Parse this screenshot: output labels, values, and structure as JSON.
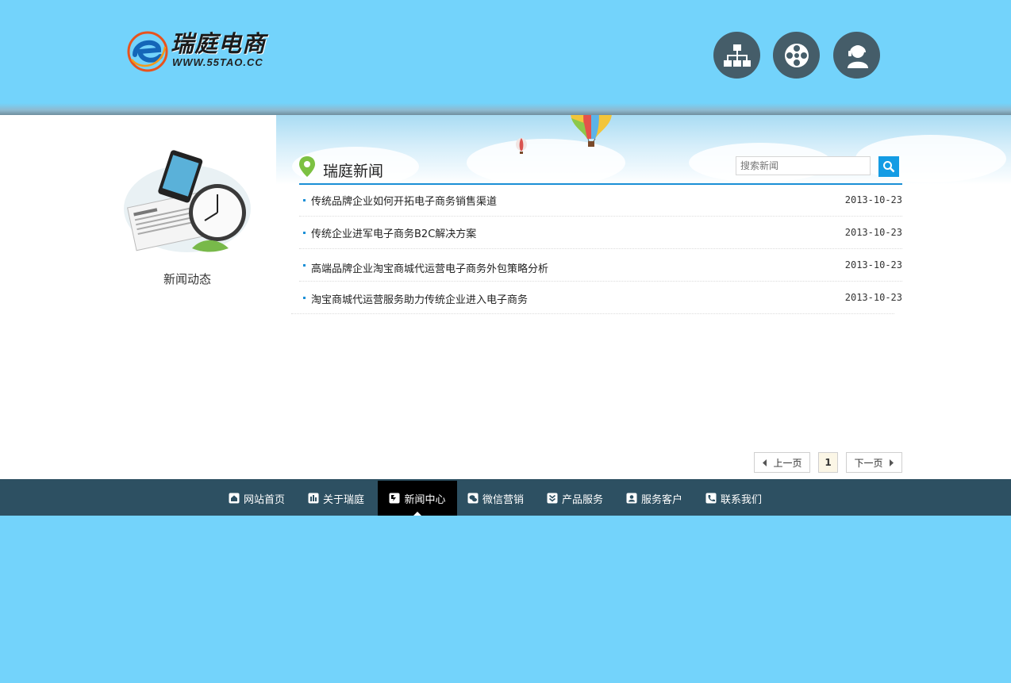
{
  "header": {
    "logo_cn": "瑞庭电商",
    "logo_en": "WWW.55TAO.CC",
    "icons": [
      "sitemap-icon",
      "film-reel-icon",
      "customer-service-icon"
    ]
  },
  "sidebar": {
    "title": "新闻动态"
  },
  "section": {
    "title": "瑞庭新闻",
    "search_placeholder": "搜索新闻"
  },
  "news": [
    {
      "title": "传统品牌企业如何开拓电子商务销售渠道",
      "date": "2013-10-23"
    },
    {
      "title": "传统企业进军电子商务B2C解决方案",
      "date": "2013-10-23"
    },
    {
      "title": "高端品牌企业淘宝商城代运营电子商务外包策略分析",
      "date": "2013-10-23"
    },
    {
      "title": "淘宝商城代运营服务助力传统企业进入电子商务",
      "date": "2013-10-23"
    }
  ],
  "pagination": {
    "prev": "上一页",
    "current": "1",
    "next": "下一页"
  },
  "nav": [
    {
      "label": "网站首页",
      "icon": "home-icon"
    },
    {
      "label": "关于瑞庭",
      "icon": "chart-icon"
    },
    {
      "label": "新闻中心",
      "icon": "news-icon"
    },
    {
      "label": "微信营销",
      "icon": "wechat-icon"
    },
    {
      "label": "产品服务",
      "icon": "product-icon"
    },
    {
      "label": "服务客户",
      "icon": "client-icon"
    },
    {
      "label": "联系我们",
      "icon": "phone-icon"
    }
  ],
  "colors": {
    "sky": "#73d3fb",
    "nav_bg": "#2d5062",
    "nav_active": "#000000",
    "accent": "#1a8fd6",
    "icon_circle": "#455d69"
  }
}
